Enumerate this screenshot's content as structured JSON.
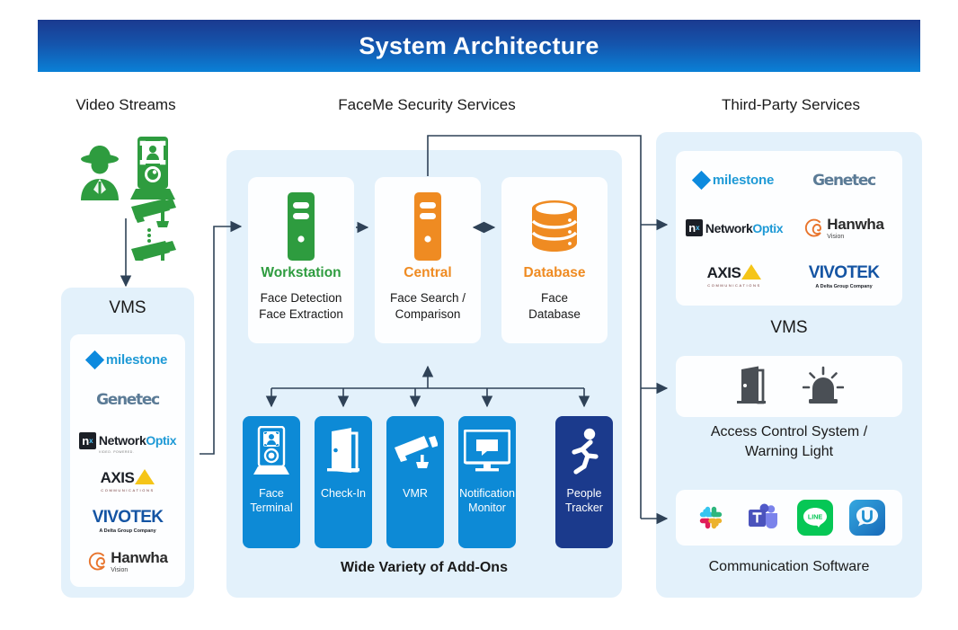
{
  "header": {
    "title": "System Architecture"
  },
  "columns": {
    "video_streams": "Video Streams",
    "faceme": "FaceMe Security Services",
    "third_party": "Third-Party Services"
  },
  "left": {
    "vms_label": "VMS",
    "source_icons": [
      "person-icon",
      "face-terminal-kiosk-icon",
      "cctv-camera-icon",
      "cctv-camera-icon"
    ],
    "vms_logos": [
      {
        "name": "milestone",
        "text": "milestone",
        "color": "#1f9ad6"
      },
      {
        "name": "genetec",
        "text": "Genetec",
        "color": "#5b7b96"
      },
      {
        "name": "networkoptix",
        "text_a": "Network",
        "text_b": "Optix",
        "badge": "n",
        "tagline": "VIDEO. POWERED.",
        "color": "#1f9ad6"
      },
      {
        "name": "axis",
        "text": "AXIS",
        "sub": "COMMUNICATIONS",
        "color": "#f5c518"
      },
      {
        "name": "vivotek",
        "text": "VIVOTEK",
        "sub": "A Delta Group Company",
        "color": "#1454a3"
      },
      {
        "name": "hanwha",
        "text": "Hanwha",
        "sub": "Vision",
        "color": "#e8742c"
      }
    ]
  },
  "center": {
    "services": [
      {
        "key": "workstation",
        "title": "Workstation",
        "title_color": "#2e9c3f",
        "desc": "Face Detection\nFace Extraction",
        "icon": "server-tower-icon"
      },
      {
        "key": "central",
        "title": "Central",
        "title_color": "#ef8b22",
        "desc": "Face Search /\nComparison",
        "icon": "server-tower-icon"
      },
      {
        "key": "database",
        "title": "Database",
        "title_color": "#ef8b22",
        "desc": "Face\nDatabase",
        "icon": "database-cylinder-icon"
      }
    ],
    "addons_caption": "Wide Variety of Add-Ons",
    "addons": [
      {
        "key": "face-terminal",
        "label": "Face\nTerminal",
        "icon": "face-terminal-icon",
        "color": "#0d8ad6"
      },
      {
        "key": "check-in",
        "label": "Check-In",
        "icon": "open-door-icon",
        "color": "#0d8ad6"
      },
      {
        "key": "vmr",
        "label": "VMR",
        "icon": "cctv-camera-icon",
        "color": "#0d8ad6"
      },
      {
        "key": "notification-monitor",
        "label": "Notification\nMonitor",
        "icon": "monitor-icon",
        "color": "#0d8ad6"
      },
      {
        "key": "people-tracker",
        "label": "People\nTracker",
        "icon": "running-person-icon",
        "color": "#1b3a8c"
      }
    ]
  },
  "right": {
    "vms_label": "VMS",
    "vms_logos": [
      {
        "name": "milestone",
        "text": "milestone"
      },
      {
        "name": "genetec",
        "text": "Genetec"
      },
      {
        "name": "networkoptix",
        "text_a": "Network",
        "text_b": "Optix"
      },
      {
        "name": "hanwha",
        "text": "Hanwha",
        "sub": "Vision"
      },
      {
        "name": "axis",
        "text": "AXIS",
        "sub": "COMMUNICATIONS"
      },
      {
        "name": "vivotek",
        "text": "VIVOTEK",
        "sub": "A Delta Group Company"
      }
    ],
    "access_label": "Access Control System /\nWarning Light",
    "access_icons": [
      "open-door-icon",
      "warning-light-siren-icon"
    ],
    "comm_label": "Communication Software",
    "comm_icons": [
      {
        "name": "slack-icon",
        "color": "#ffffff"
      },
      {
        "name": "microsoft-teams-icon",
        "color": "#5059c9"
      },
      {
        "name": "line-icon",
        "color": "#06c755"
      },
      {
        "name": "u-messenger-icon",
        "color": "#1d8fd1"
      }
    ]
  },
  "colors": {
    "header_top": "#1b3a8f",
    "header_bottom": "#0a80d6",
    "panel_bg": "#e3f1fb",
    "accent_green": "#2e9c3f",
    "accent_orange": "#ef8b22",
    "accent_blue": "#0d8ad6",
    "accent_navy": "#1b3a8c",
    "arrow": "#2f4257"
  }
}
